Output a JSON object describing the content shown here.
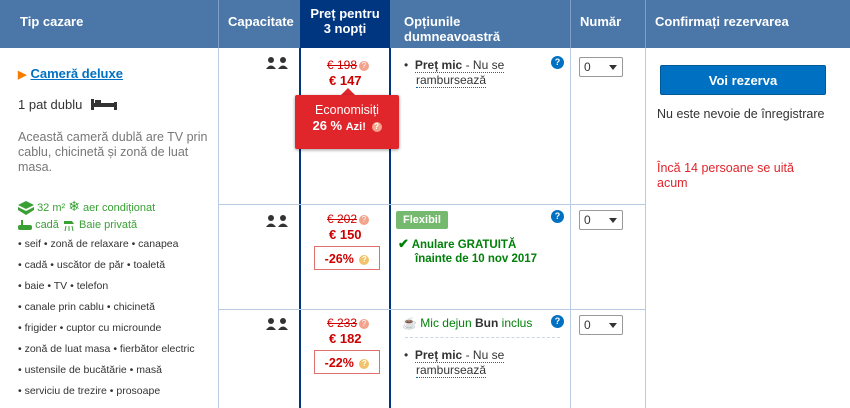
{
  "header": {
    "col_type": "Tip cazare",
    "col_capacity": "Capacitate",
    "col_price_line1": "Preț pentru",
    "col_price_line2": "3 nopți",
    "col_options": "Opțiunile dumneavoastră",
    "col_number": "Număr",
    "col_confirm": "Confirmați rezervarea"
  },
  "room": {
    "title": "Cameră deluxe",
    "bed": "1 pat dublu",
    "description": "Această cameră dublă are TV prin cablu, chicinetă și zonă de luat masa.",
    "size": "32 m²",
    "ac": "aer condiționat",
    "bath": "cadă",
    "private_bath": "Baie privată",
    "amenities": [
      "• seif • zonă de relaxare • canapea",
      "• cadă • uscător de păr • toaletă",
      "• baie • TV • telefon",
      "• canale prin cablu • chicinetă",
      "• frigider • cuptor cu microunde",
      "• zonă de luat masa • fierbător electric",
      "• ustensile de bucătărie • masă",
      "• serviciu de trezire • prosoape"
    ]
  },
  "rows": [
    {
      "old_price": "€ 198",
      "new_price": "€ 147",
      "option_bold": "Preț mic",
      "option_rest": " - Nu se",
      "option_rest2": "rambursează",
      "select_value": "0"
    },
    {
      "old_price": "€ 202",
      "new_price": "€ 150",
      "discount": "-26%",
      "badge": "Flexibil",
      "cancel_line1": "Anulare GRATUITĂ",
      "cancel_line2": "înainte de 10 nov 2017",
      "select_value": "0"
    },
    {
      "old_price": "€ 233",
      "new_price": "€ 182",
      "discount": "-22%",
      "breakfast_pre": "Mic dejun ",
      "breakfast_bold": "Bun",
      "breakfast_post": " inclus",
      "option_bold": "Preț mic",
      "option_rest": " - Nu se",
      "option_rest2": "rambursează",
      "select_value": "0"
    }
  ],
  "savings": {
    "line1": "Economisiți",
    "pct": "26 %",
    "today": "Azi!"
  },
  "confirm": {
    "button": "Voi rezerva",
    "note": "Nu este nevoie de înregistrare",
    "viewers": "Încă 14 persoane se uită acum"
  },
  "colors": {
    "header_bg": "#4a76a8",
    "selected_header_bg": "#003580",
    "button_bg": "#0071c2",
    "price_red": "#cc0000",
    "green": "#008009"
  }
}
